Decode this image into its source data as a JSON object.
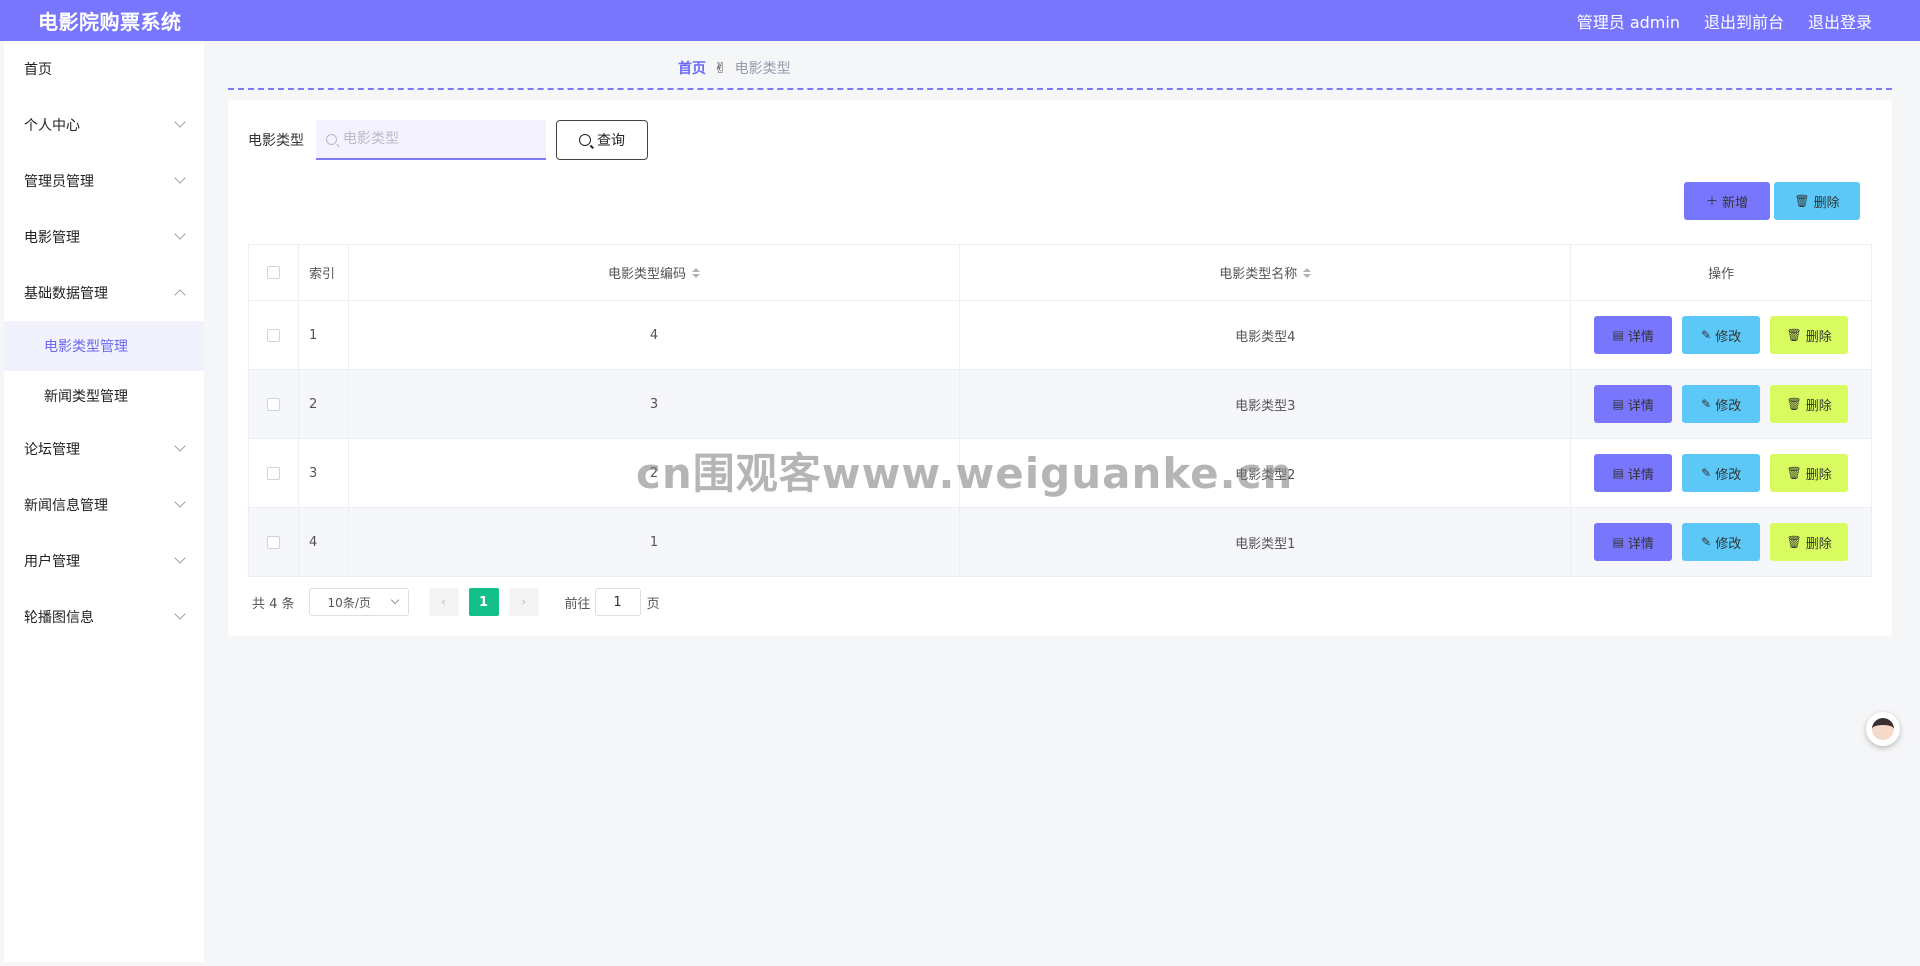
{
  "header": {
    "title": "电影院购票系统",
    "user_label": "管理员 admin",
    "back_front": "退出到前台",
    "logout": "退出登录"
  },
  "sidebar": {
    "items": [
      {
        "label": "首页"
      },
      {
        "label": "个人中心"
      },
      {
        "label": "管理员管理"
      },
      {
        "label": "电影管理"
      },
      {
        "label": "基础数据管理"
      },
      {
        "label": "电影类型管理"
      },
      {
        "label": "新闻类型管理"
      },
      {
        "label": "论坛管理"
      },
      {
        "label": "新闻信息管理"
      },
      {
        "label": "用户管理"
      },
      {
        "label": "轮播图信息"
      }
    ]
  },
  "breadcrumb": {
    "home": "首页",
    "separator": "✌",
    "current": "电影类型"
  },
  "filter": {
    "label": "电影类型",
    "placeholder": "电影类型",
    "query_label": "查询"
  },
  "toolbar": {
    "add_label": "新增",
    "delete_label": "删除"
  },
  "table": {
    "headers": {
      "index": "索引",
      "code": "电影类型编码",
      "name": "电影类型名称",
      "ops": "操作"
    },
    "rows": [
      {
        "index": "1",
        "code": "4",
        "name": "电影类型4"
      },
      {
        "index": "2",
        "code": "3",
        "name": "电影类型3"
      },
      {
        "index": "3",
        "code": "2",
        "name": "电影类型2"
      },
      {
        "index": "4",
        "code": "1",
        "name": "电影类型1"
      }
    ],
    "op_labels": {
      "detail": "详情",
      "edit": "修改",
      "delete": "删除"
    }
  },
  "pagination": {
    "total_text": "共 4 条",
    "page_size": "10条/页",
    "current_page": "1",
    "goto_prefix": "前往",
    "goto_value": "1",
    "goto_suffix": "页"
  },
  "watermark": "cn围观客www.weiguanke.cn",
  "colors": {
    "header_bg": "#7876fc",
    "detail_btn": "#7876fc",
    "edit_btn": "#5bc8f8",
    "delete_btn": "#d8fb60",
    "active_page": "#13c08a"
  }
}
